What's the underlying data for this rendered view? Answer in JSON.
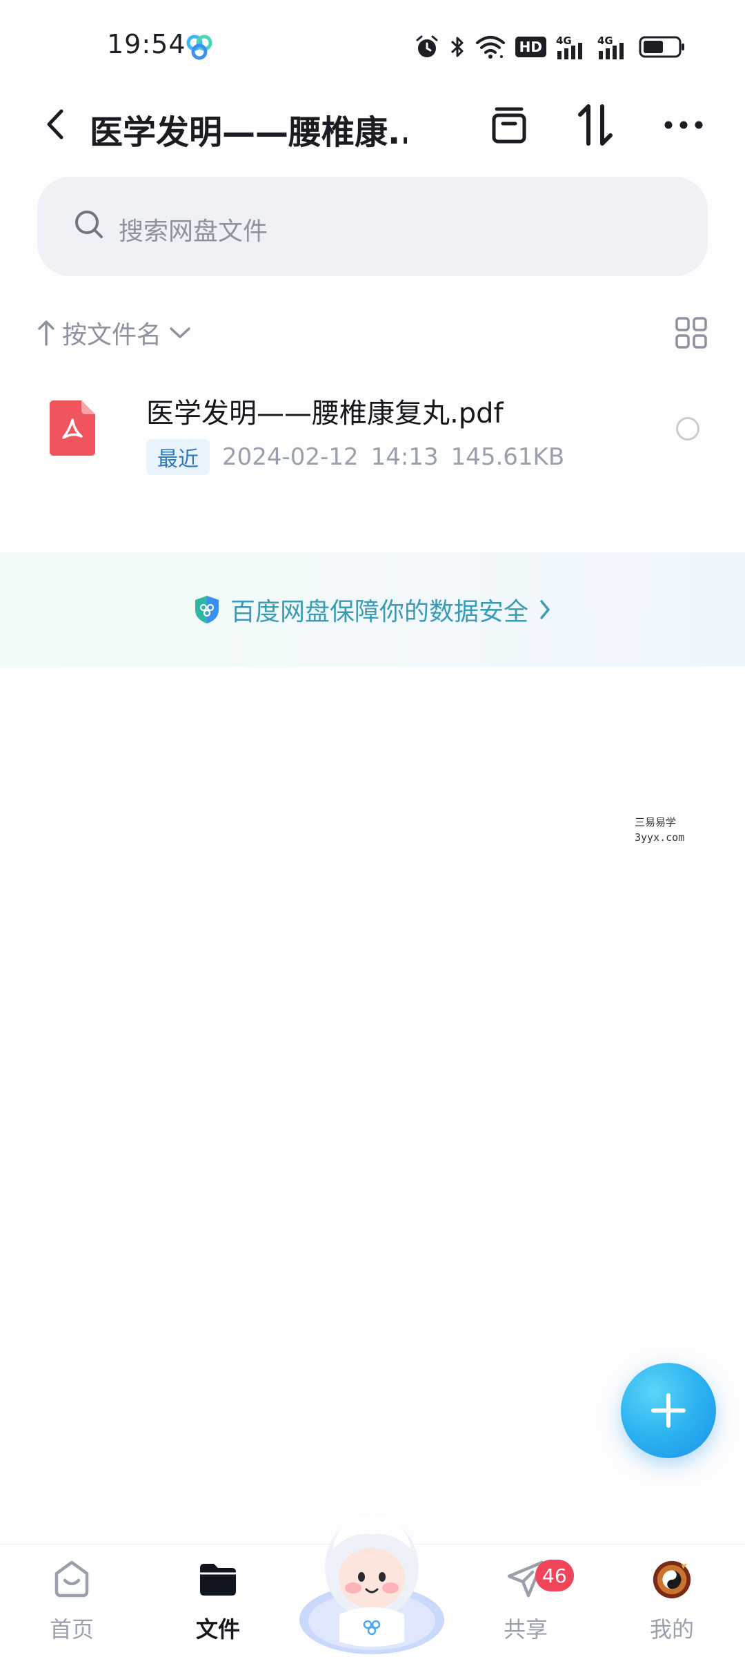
{
  "status_bar": {
    "time": "19:54",
    "icons": [
      "baidu-netdisk-icon",
      "alarm-icon",
      "bluetooth-icon",
      "wifi-icon",
      "hd-icon",
      "signal-4g-icon",
      "signal-4g-icon",
      "battery-icon"
    ],
    "hd_label": "HD",
    "network_label": "4G"
  },
  "header": {
    "title": "医学发明——腰椎康...",
    "icons": [
      "back-icon",
      "archive-icon",
      "sort-order-icon",
      "more-icon"
    ]
  },
  "search": {
    "placeholder": "搜索网盘文件"
  },
  "sort": {
    "label": "按文件名"
  },
  "files": [
    {
      "name": "医学发明——腰椎康复丸.pdf",
      "badge": "最近",
      "date": "2024-02-12",
      "time": "14:13",
      "size": "145.61KB",
      "icon": "pdf-icon"
    }
  ],
  "banner": {
    "text": "百度网盘保障你的数据安全"
  },
  "watermark": {
    "line1": "三易易学",
    "line2": "3yyx.com"
  },
  "bottom_nav": {
    "items": [
      {
        "label": "首页",
        "icon": "home-icon"
      },
      {
        "label": "文件",
        "icon": "folder-icon",
        "active": true
      },
      {
        "label": "",
        "icon": "mascot-icon"
      },
      {
        "label": "共享",
        "icon": "share-icon",
        "badge": "46"
      },
      {
        "label": "我的",
        "icon": "avatar-icon"
      }
    ]
  },
  "colors": {
    "accent": "#2bb3f0",
    "badge_red": "#f0445b",
    "pdf_red": "#f0555e",
    "banner_text": "#3a9bb4"
  }
}
